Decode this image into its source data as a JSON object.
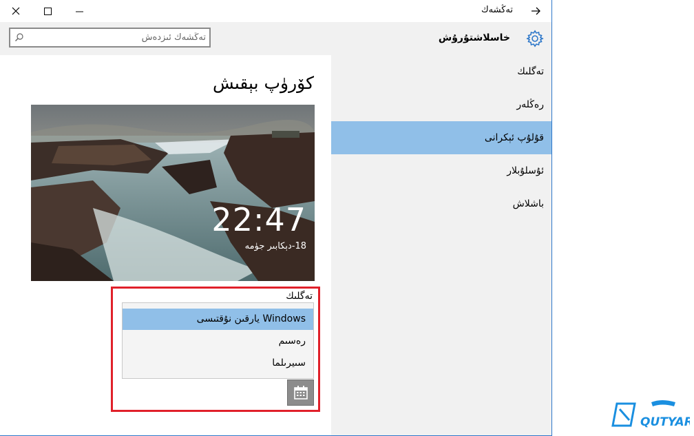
{
  "window": {
    "title": "تەڭشەك",
    "controls": {
      "close_icon": "close-icon",
      "maximize_icon": "maximize-icon",
      "minimize_icon": "minimize-icon",
      "back_icon": "back-arrow-icon"
    }
  },
  "header": {
    "title": "خاسلاشتۇرۇش",
    "search_placeholder": "تەڭشەك ئىزدەش"
  },
  "nav": {
    "items": [
      {
        "label": "تەگلىك",
        "selected": false
      },
      {
        "label": "رەڭلەر",
        "selected": false
      },
      {
        "label": "قۇلۇپ ئېكرانى",
        "selected": true
      },
      {
        "label": "ئۇسلۇبلار",
        "selected": false
      },
      {
        "label": "باشلاش",
        "selected": false
      }
    ]
  },
  "content": {
    "page_title": "كۆرۈپ بېقىش",
    "preview": {
      "time": "22:47",
      "date": "18-دېكابىر جۈمە"
    },
    "background_label": "تەگلىك",
    "background_options": [
      {
        "label": "Windows يارقىن نۇقتىسى",
        "selected": true
      },
      {
        "label": "رەسىم",
        "selected": false
      },
      {
        "label": "سىيرىلما",
        "selected": false
      }
    ],
    "calendar_icon": "calendar-icon"
  },
  "colors": {
    "accent": "#90bfe8",
    "highlight_box": "#e0202a",
    "nav_background": "#f1f1f1"
  },
  "watermark": {
    "brand": "QUTYAR"
  }
}
